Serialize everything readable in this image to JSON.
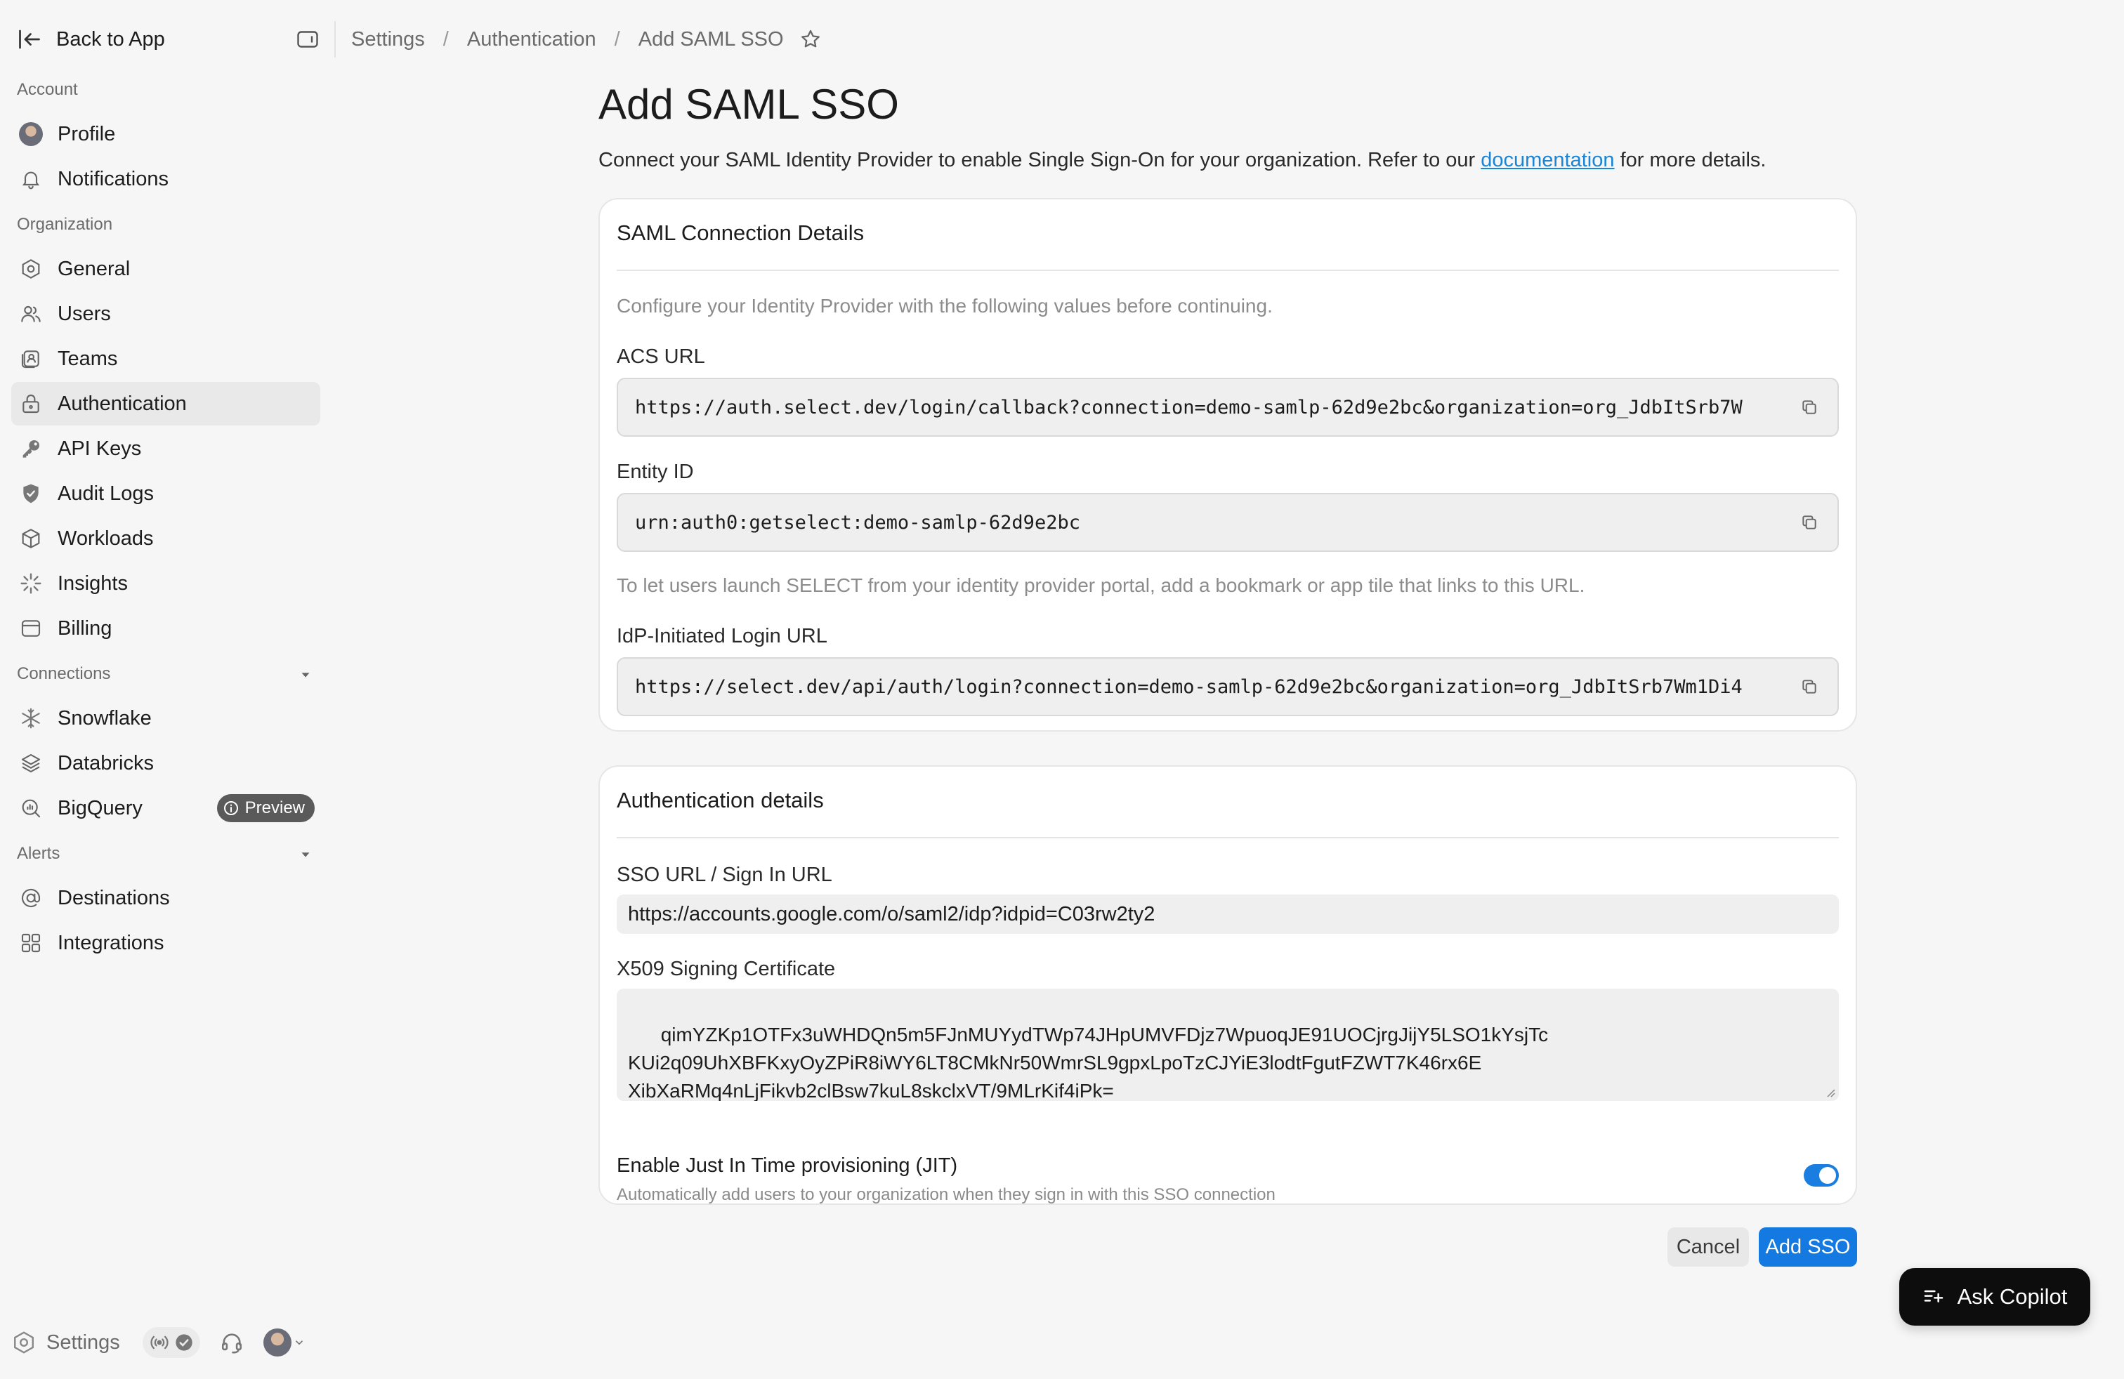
{
  "sidebar": {
    "back_label": "Back to App",
    "sections": {
      "account": "Account",
      "organization": "Organization",
      "connections": "Connections",
      "alerts": "Alerts"
    },
    "items": {
      "profile": "Profile",
      "notifications": "Notifications",
      "general": "General",
      "users": "Users",
      "teams": "Teams",
      "authentication": "Authentication",
      "api_keys": "API Keys",
      "audit_logs": "Audit Logs",
      "workloads": "Workloads",
      "insights": "Insights",
      "billing": "Billing",
      "snowflake": "Snowflake",
      "databricks": "Databricks",
      "bigquery": "BigQuery",
      "destinations": "Destinations",
      "integrations": "Integrations"
    },
    "bigquery_badge": "Preview",
    "active_item": "Authentication",
    "footer_settings": "Settings"
  },
  "breadcrumb": {
    "items": [
      "Settings",
      "Authentication",
      "Add SAML SSO"
    ],
    "separator": "/"
  },
  "page": {
    "title": "Add SAML SSO",
    "description_prefix": "Connect your SAML Identity Provider to enable Single Sign-On for your organization. Refer to our ",
    "description_link": "documentation",
    "description_suffix": " for more details."
  },
  "saml_card": {
    "title": "SAML Connection Details",
    "hint": "Configure your Identity Provider with the following values before continuing.",
    "acs_label": "ACS URL",
    "acs_value": "https://auth.select.dev/login/callback?connection=demo-samlp-62d9e2bc&organization=org_JdbItSrb7W",
    "entity_label": "Entity ID",
    "entity_value": "urn:auth0:getselect:demo-samlp-62d9e2bc",
    "idp_hint": "To let users launch SELECT from your identity provider portal, add a bookmark or app tile that links to this URL.",
    "idp_label": "IdP-Initiated Login URL",
    "idp_value": "https://select.dev/api/auth/login?connection=demo-samlp-62d9e2bc&organization=org_JdbItSrb7Wm1Di4"
  },
  "auth_card": {
    "title": "Authentication details",
    "sso_label": "SSO URL / Sign In URL",
    "sso_value": "https://accounts.google.com/o/saml2/idp?idpid=C03rw2ty2",
    "cert_label": "X509 Signing Certificate",
    "cert_value": "qimYZKp1OTFx3uWHDQn5m5FJnMUYydTWp74JHpUMVFDjz7WpuoqJE91UOCjrgJijY5LSO1kYsjTc\nKUi2q09UhXBFKxyOyZPiR8iWY6LT8CMkNr50WmrSL9gpxLpoTzCJYiE3lodtFgutFZWT7K46rx6E\nXibXaRMq4nLjFikvb2clBsw7kuL8skclxVT/9MLrKif4iPk=\n-----END CERTIFICATE-----",
    "jit_label": "Enable Just In Time provisioning (JIT)",
    "jit_description": "Automatically add users to your organization when they sign in with this SSO connection",
    "jit_enabled": true
  },
  "actions": {
    "cancel": "Cancel",
    "submit": "Add SSO"
  },
  "copilot": {
    "label": "Ask Copilot"
  },
  "colors": {
    "accent": "#1479e0",
    "link": "#1a84d6",
    "toggle_on": "#1a7ee0"
  }
}
